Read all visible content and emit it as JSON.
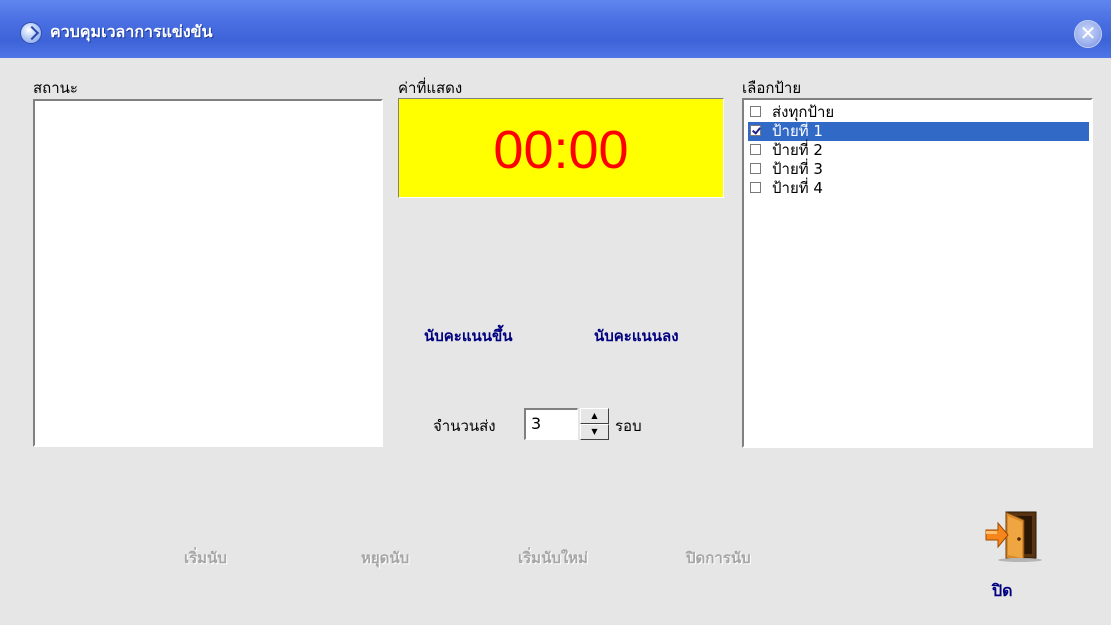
{
  "window": {
    "title": "ควบคุมเวลาการแข่งขัน",
    "close_icon": "close-icon",
    "app_icon": "app-icon"
  },
  "status": {
    "label": "สถานะ"
  },
  "display": {
    "label": "ค่าที่แสดง",
    "value": "00:00",
    "background_color": "#ffff00",
    "value_color": "#ff0000"
  },
  "signs": {
    "label": "เลือกป้าย",
    "items": [
      {
        "label": "ส่งทุกป้าย",
        "checked": false,
        "selected": false
      },
      {
        "label": "ป้ายที่ 1",
        "checked": true,
        "selected": true
      },
      {
        "label": "ป้ายที่ 2",
        "checked": false,
        "selected": false
      },
      {
        "label": "ป้ายที่ 3",
        "checked": false,
        "selected": false
      },
      {
        "label": "ป้ายที่ 4",
        "checked": false,
        "selected": false
      }
    ],
    "selection_color": "#3169c6"
  },
  "count": {
    "up_label": "นับคะแนนขึ้น",
    "down_label": "นับคะแนนลง"
  },
  "send": {
    "label": "จำนวนส่ง",
    "value": "3",
    "unit": "รอบ"
  },
  "actions": {
    "start": "เริ่มนับ",
    "stop": "หยุดนับ",
    "restart": "เริ่มนับใหม่",
    "end": "ปิดการนับ",
    "disabled_color": "#a6a6a6"
  },
  "exit": {
    "label": "ปิด",
    "icon": "exit-door-icon"
  }
}
